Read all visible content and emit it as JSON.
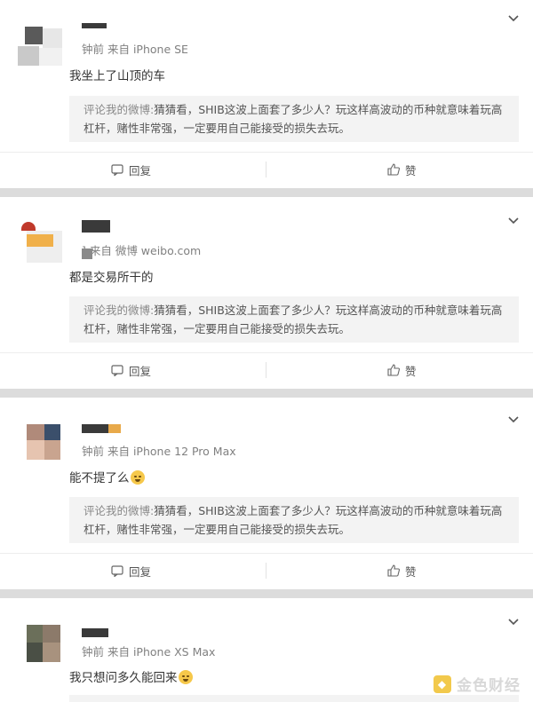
{
  "comments": [
    {
      "meta": "钟前 来自 iPhone SE",
      "text": "我坐上了山顶的车",
      "quote_label": "评论我的微博:",
      "quote_line1": "猜猜看，SHIB这波上面套了多少人？玩这样高波动的币种就意味着玩高",
      "quote_line2": "杠杆，赌性非常强，一定要用自己能接受的损失去玩。",
      "reply": "回复",
      "like": "赞"
    },
    {
      "meta": "] 来自 微博 weibo.com",
      "text": "都是交易所干的",
      "quote_label": "评论我的微博:",
      "quote_line1": "猜猜看，SHIB这波上面套了多少人？玩这样高波动的币种就意味着玩高",
      "quote_line2": "杠杆，赌性非常强，一定要用自己能接受的损失去玩。",
      "reply": "回复",
      "like": "赞"
    },
    {
      "meta": "钟前 来自 iPhone 12 Pro Max",
      "text": "能不提了么",
      "quote_label": "评论我的微博:",
      "quote_line1": "猜猜看，SHIB这波上面套了多少人？玩这样高波动的币种就意味着玩高",
      "quote_line2": "杠杆，赌性非常强，一定要用自己能接受的损失去玩。",
      "reply": "回复",
      "like": "赞"
    },
    {
      "meta": "钟前 来自 iPhone XS Max",
      "text": "我只想问多久能回来"
    }
  ],
  "watermark": "金色财经",
  "icons": [
    "chevron-down-icon",
    "reply-icon",
    "like-icon",
    "crying-emoji-icon"
  ]
}
